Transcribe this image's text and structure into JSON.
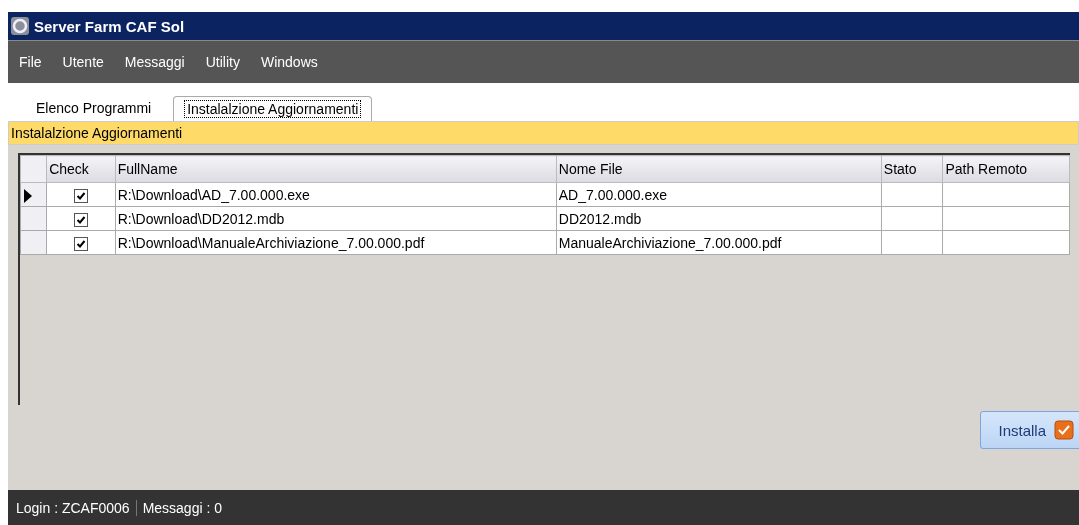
{
  "window": {
    "title": "Server Farm CAF Sol"
  },
  "menu": [
    "File",
    "Utente",
    "Messaggi",
    "Utility",
    "Windows"
  ],
  "tabs": [
    {
      "label": "Elenco Programmi",
      "selected": false
    },
    {
      "label": "Instalalzione Aggiornamenti",
      "selected": true
    }
  ],
  "panel_header": "Instalalzione Aggiornamenti",
  "table": {
    "columns": [
      "Check",
      "FullName",
      "Nome File",
      "Stato",
      "Path Remoto"
    ],
    "rows": [
      {
        "current": true,
        "checked": true,
        "full_name": "R:\\Download\\AD_7.00.000.exe",
        "file_name": "AD_7.00.000.exe"
      },
      {
        "current": false,
        "checked": true,
        "full_name": "R:\\Download\\DD2012.mdb",
        "file_name": "DD2012.mdb"
      },
      {
        "current": false,
        "checked": true,
        "full_name": "R:\\Download\\ManualeArchiviazione_7.00.000.pdf",
        "file_name": "ManualeArchiviazione_7.00.000.pdf"
      }
    ]
  },
  "install_button": "Installa",
  "status_bar": [
    "Login : ZCAF0006",
    "Messaggi : 0"
  ]
}
